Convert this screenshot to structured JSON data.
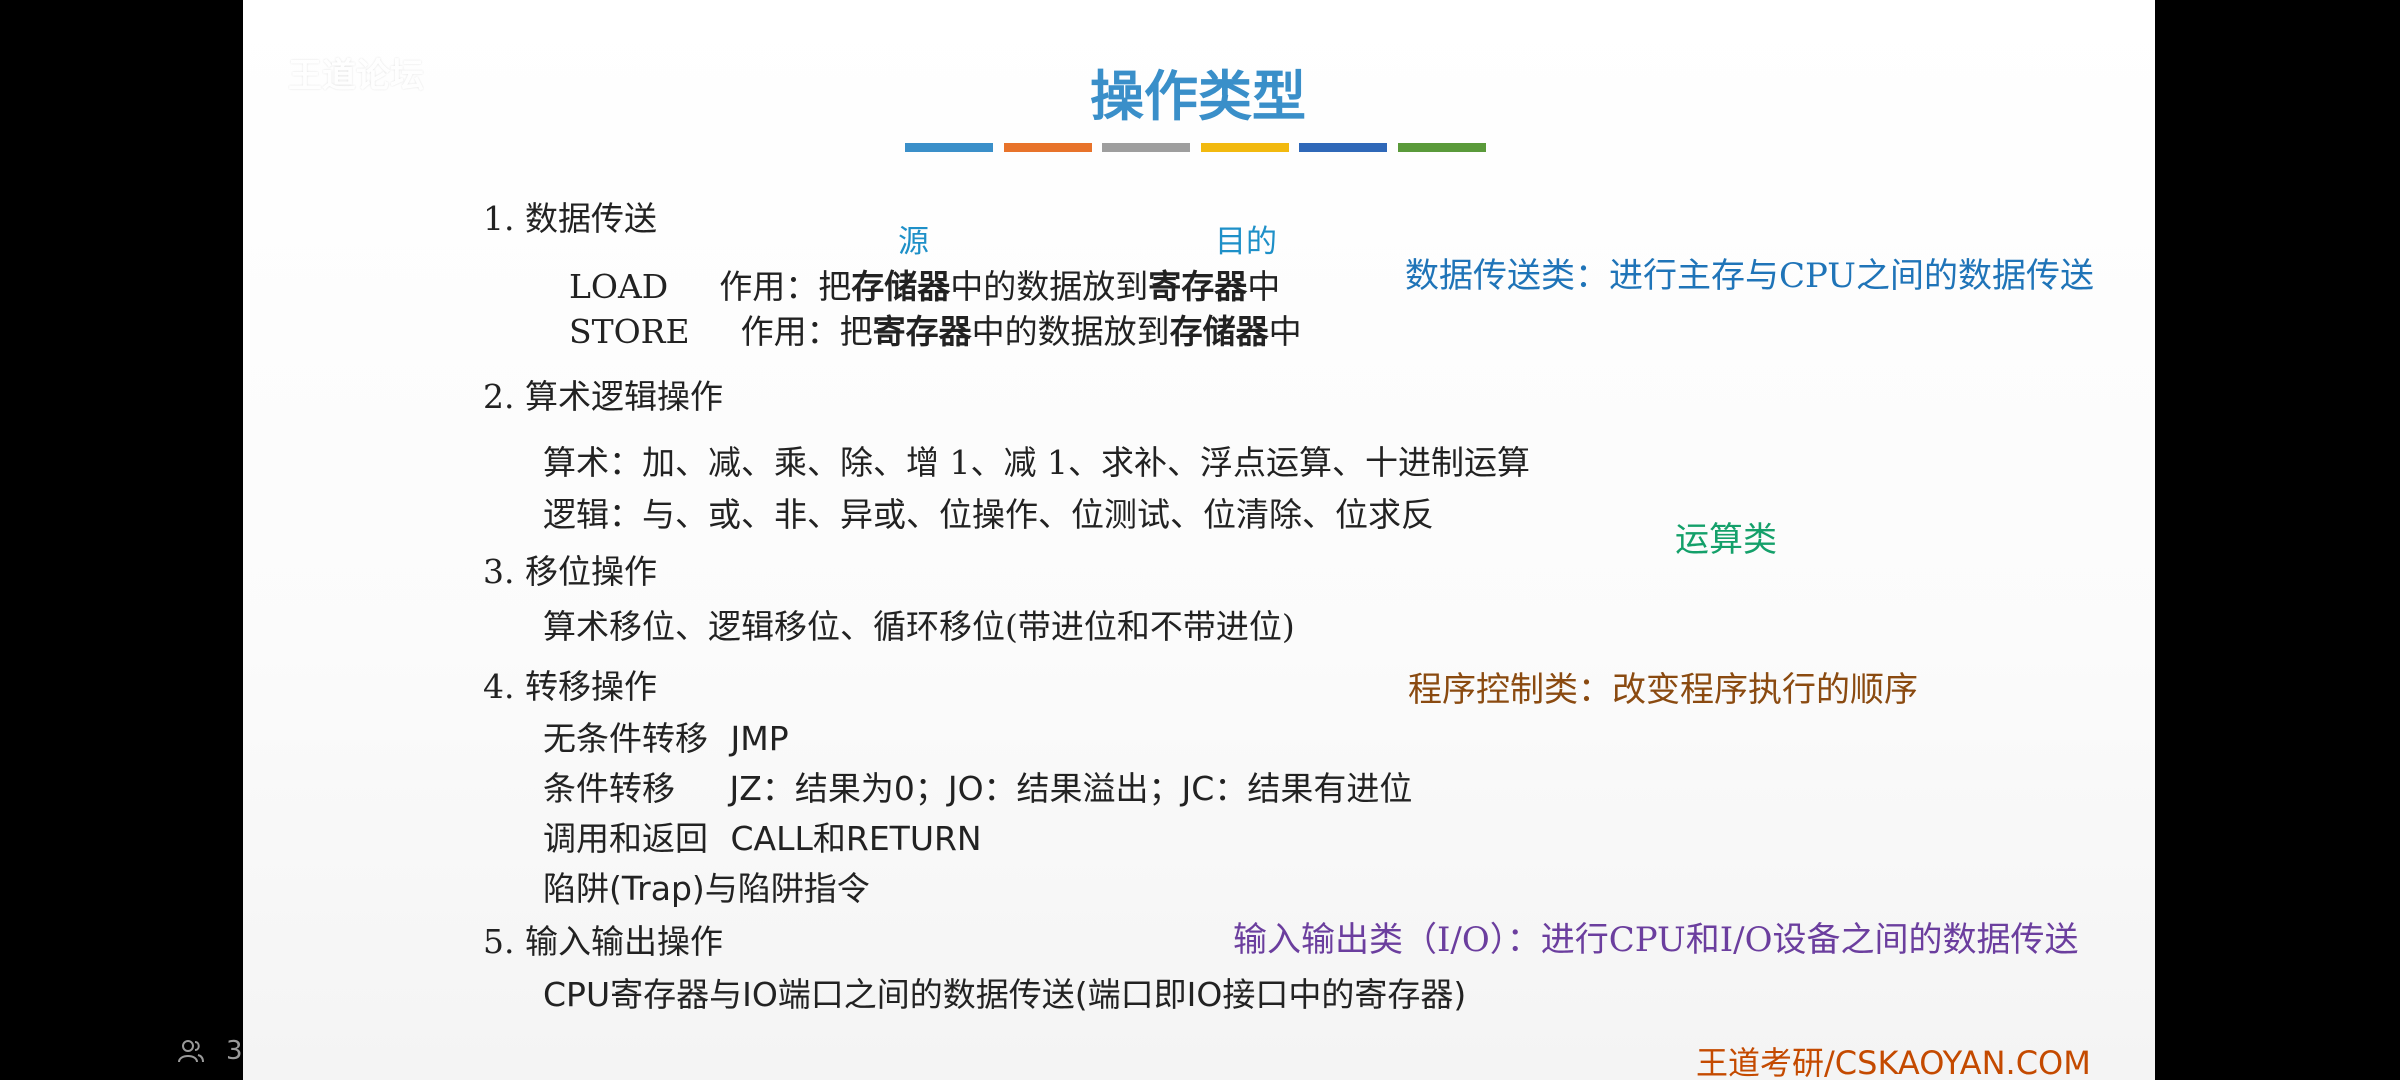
{
  "slide": {
    "title": "操作类型",
    "watermark": "王道论坛",
    "bar_colors": [
      "#3a8fc9",
      "#e8732a",
      "#9e9e9e",
      "#f2b90f",
      "#2f68b8",
      "#5a9a3a"
    ],
    "sections": [
      {
        "heading": "1. 数据传送",
        "annotations": {
          "source": "源",
          "destination": "目的"
        },
        "lines": [
          {
            "op": "LOAD",
            "prefix": "作用：把",
            "bold1": "存储器",
            "mid": "中的数据放到",
            "bold2": "寄存器",
            "suffix": "中"
          },
          {
            "op": "STORE",
            "prefix": "作用：把",
            "bold1": "寄存器",
            "mid": "中的数据放到",
            "bold2": "存储器",
            "suffix": "中"
          }
        ],
        "note": "数据传送类：进行主存与CPU之间的数据传送"
      },
      {
        "heading": "2. 算术逻辑操作",
        "lines": [
          "算术：加、减、乘、除、增 1、减 1、求补、浮点运算、十进制运算",
          "逻辑：与、或、非、异或、位操作、位测试、位清除、位求反"
        ],
        "note": "运算类"
      },
      {
        "heading": "3. 移位操作",
        "lines": [
          "算术移位、逻辑移位、循环移位(带进位和不带进位)"
        ]
      },
      {
        "heading": "4. 转移操作",
        "lines": [
          {
            "label": "无条件转移",
            "detail": "JMP"
          },
          {
            "label": "条件转移",
            "detail": "JZ：结果为0；JO：结果溢出；JC：结果有进位"
          },
          {
            "label": "调用和返回",
            "detail": "CALL和RETURN"
          },
          {
            "label": "陷阱(Trap)与陷阱指令",
            "detail": ""
          }
        ],
        "note": "程序控制类：改变程序执行的顺序"
      },
      {
        "heading": "5. 输入输出操作",
        "lines": [
          "CPU寄存器与IO端口之间的数据传送(端口即IO接口中的寄存器)"
        ],
        "note": "输入输出类（I/O）：进行CPU和I/O设备之间的数据传送"
      }
    ],
    "footer": "王道考研/CSKAOYAN.COM"
  },
  "player": {
    "viewer_count": "3",
    "viewer_icon": "people-icon"
  }
}
